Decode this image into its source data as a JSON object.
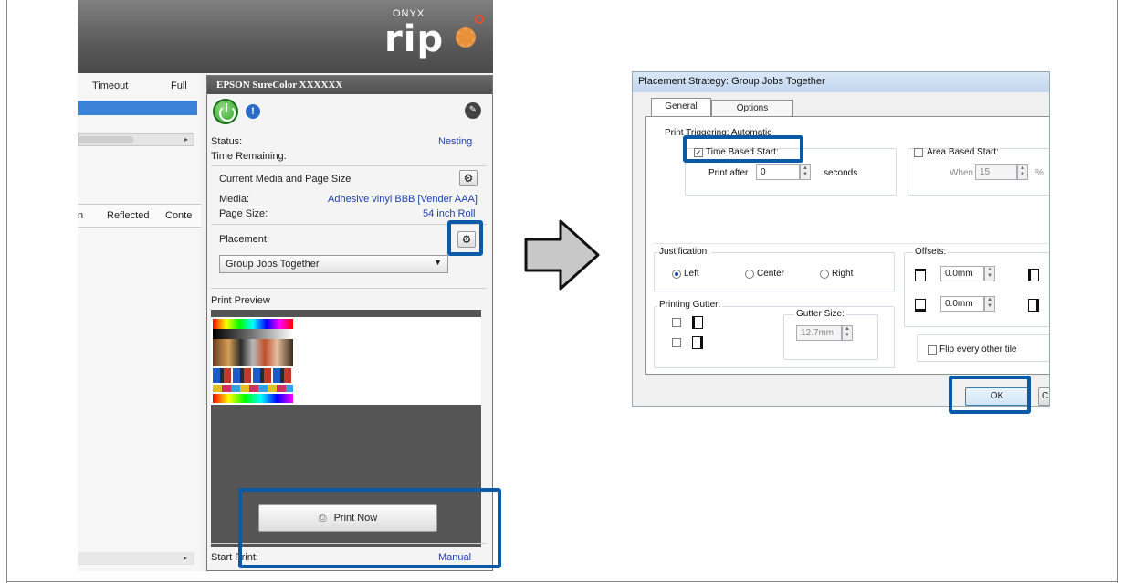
{
  "left_app": {
    "logo_brand": "ONYX",
    "logo_product": "rip",
    "job_table": {
      "columns": [
        "Timeout",
        "Full"
      ],
      "lower_columns": [
        "n",
        "Reflected",
        "Conte"
      ]
    },
    "panel": {
      "printer_name": "EPSON SureColor XXXXXX",
      "status_label": "Status:",
      "status_value": "Nesting",
      "time_remaining_label": "Time Remaining:",
      "current_media_heading": "Current Media and Page Size",
      "media_label": "Media:",
      "media_value": "Adhesive vinyl BBB [Vender AAA]",
      "page_size_label": "Page Size:",
      "page_size_value": "54 inch Roll",
      "placement_heading": "Placement",
      "placement_value": "Group Jobs Together",
      "print_preview_heading": "Print Preview",
      "print_now_label": "Print Now",
      "start_print_label": "Start Print:",
      "start_print_value": "Manual"
    }
  },
  "dialog": {
    "title": "Placement Strategy: Group Jobs Together",
    "tabs": [
      {
        "label": "General",
        "active": true
      },
      {
        "label": "Options",
        "active": false
      }
    ],
    "print_triggering": {
      "heading": "Print Triggering: Automatic",
      "time_based_label": "Time Based Start:",
      "time_based_checked": true,
      "print_after_label": "Print after",
      "print_after_value": "0",
      "seconds_label": "seconds",
      "area_based_label": "Area Based Start:",
      "area_based_checked": false,
      "when_label": "When",
      "when_value": "15",
      "percent_label": "%"
    },
    "justification": {
      "heading": "Justification:",
      "options": [
        "Left",
        "Center",
        "Right"
      ],
      "selected": "Left"
    },
    "offsets": {
      "heading": "Offsets:",
      "top_value": "0.0mm",
      "bottom_value": "0.0mm"
    },
    "printing_gutter": {
      "heading": "Printing Gutter:",
      "gutter_size_label": "Gutter Size:",
      "gutter_size_value": "12.7mm"
    },
    "flip_label": "Flip every other tile",
    "ok_label": "OK",
    "cancel_label": "C"
  },
  "colors": {
    "highlight": "#0b5aa8",
    "selection": "#3b83d9",
    "link_blue": "#1f3fb0"
  }
}
